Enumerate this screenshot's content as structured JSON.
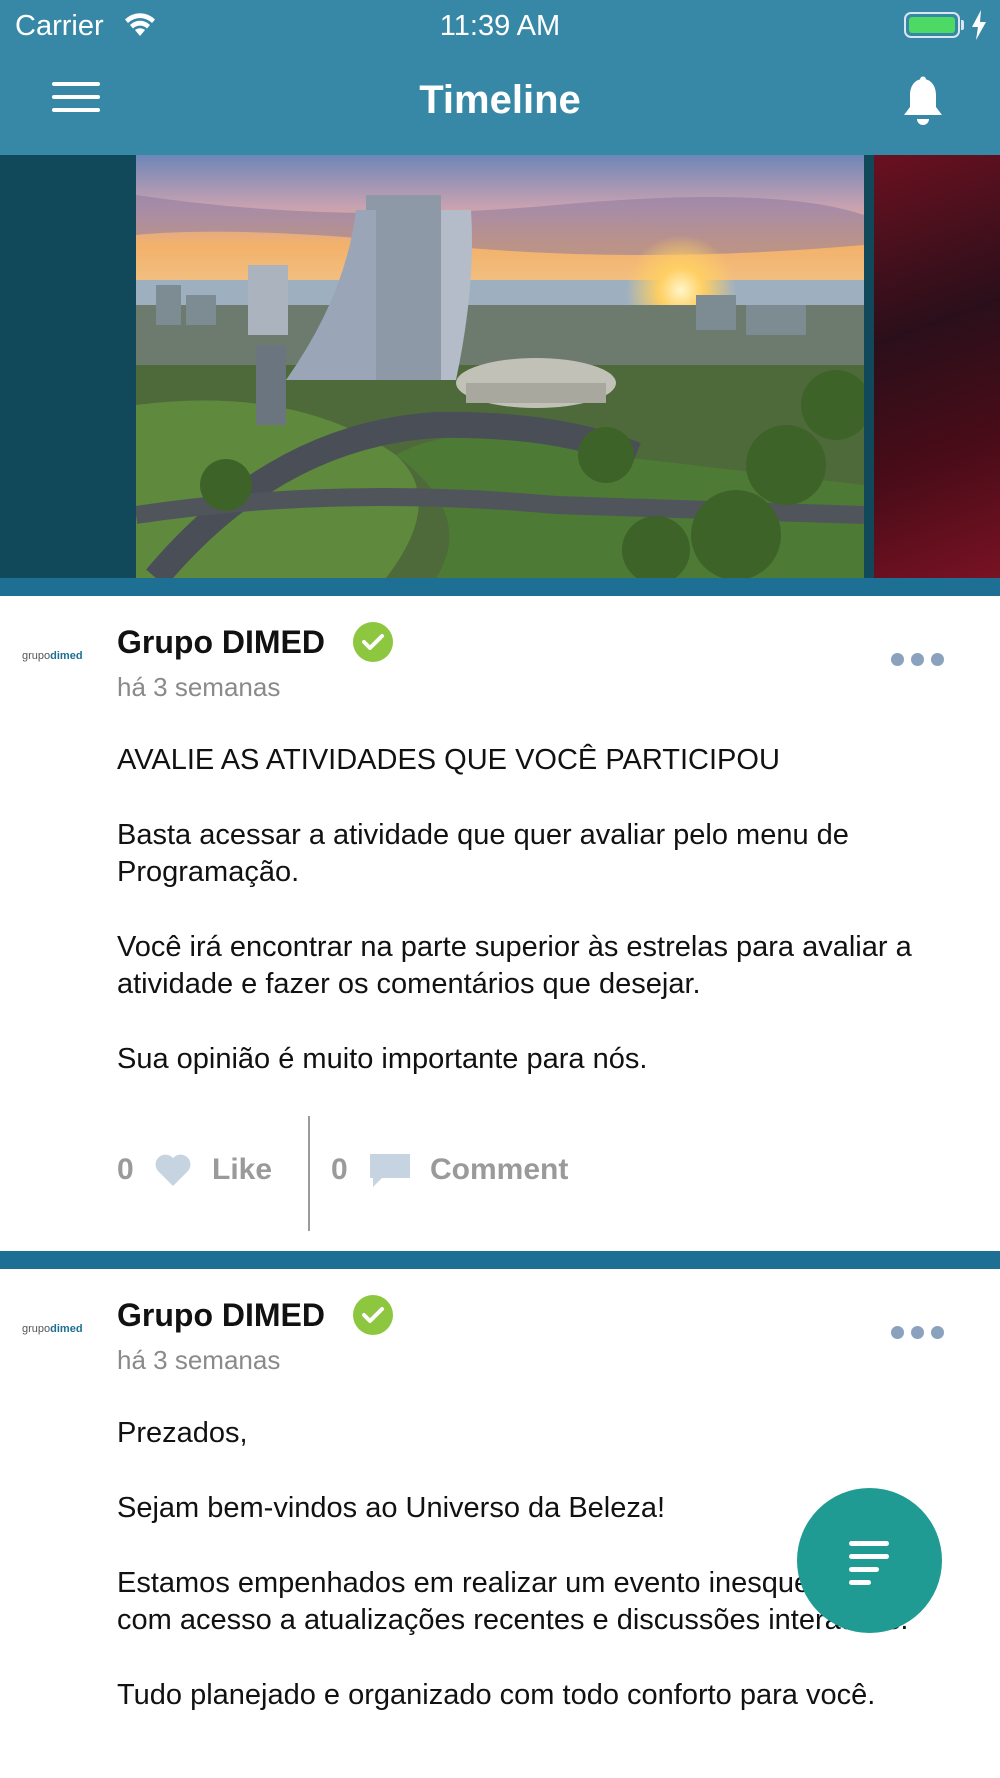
{
  "status_bar": {
    "carrier": "Carrier",
    "time": "11:39 AM"
  },
  "nav": {
    "title": "Timeline",
    "menu_icon": "hamburger-menu-icon",
    "bell_icon": "bell-icon"
  },
  "carousel": {
    "image_label": "city-sunset-photo"
  },
  "posts": [
    {
      "avatar_prefix": "grupo",
      "avatar_brand": "dimed",
      "author": "Grupo DIMED",
      "time_ago": "há 3 semanas",
      "paragraphs": [
        "AVALIE AS ATIVIDADES QUE VOCÊ PARTICIPOU",
        "Basta acessar a atividade que quer avaliar pelo menu de Programação.",
        "Você irá encontrar na parte superior às estrelas para avaliar a atividade e fazer os comentários que desejar.",
        "Sua opinião é muito importante para nós."
      ],
      "likes": "0",
      "like_label": "Like",
      "comments": "0",
      "comment_label": "Comment"
    },
    {
      "avatar_prefix": "grupo",
      "avatar_brand": "dimed",
      "author": "Grupo DIMED",
      "time_ago": "há 3 semanas",
      "paragraphs": [
        "Prezados,",
        "Sejam bem-vindos ao Universo da Beleza!",
        "Estamos empenhados em realizar um evento inesquecível, com acesso a atualizações recentes e discussões interativas.",
        "Tudo planejado e organizado com todo conforto para você."
      ]
    }
  ],
  "colors": {
    "header": "#3788a6",
    "band": "#1d6f93",
    "verified": "#8dc63f",
    "fab": "#1f9b93"
  }
}
